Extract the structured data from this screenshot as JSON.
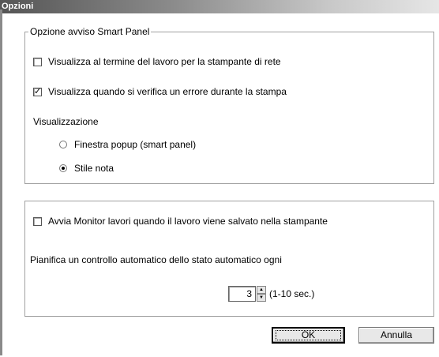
{
  "window": {
    "title": "Opzioni"
  },
  "smart_panel": {
    "legend": "Opzione avviso Smart Panel",
    "network_check": {
      "label": "Visualizza al termine del lavoro per la stampante di rete",
      "checked": false
    },
    "error_check": {
      "label": "Visualizza quando si verifica un errore durante la stampa",
      "checked": true
    },
    "display_label": "Visualizzazione",
    "radio_popup": {
      "label": "Finestra popup (smart panel)",
      "selected": false
    },
    "radio_note": {
      "label": "Stile nota",
      "selected": true
    }
  },
  "monitor": {
    "start_monitor": {
      "label": "Avvia Monitor lavori quando il lavoro viene salvato nella stampante",
      "checked": false
    },
    "schedule_label": "Pianifica un controllo automatico dello stato automatico ogni",
    "interval_value": "3",
    "interval_suffix": "(1-10 sec.)"
  },
  "buttons": {
    "ok": "OK",
    "cancel": "Annulla"
  },
  "icons": {
    "spin_up": "up-arrow-icon",
    "spin_down": "down-arrow-icon",
    "check": "check-icon"
  }
}
